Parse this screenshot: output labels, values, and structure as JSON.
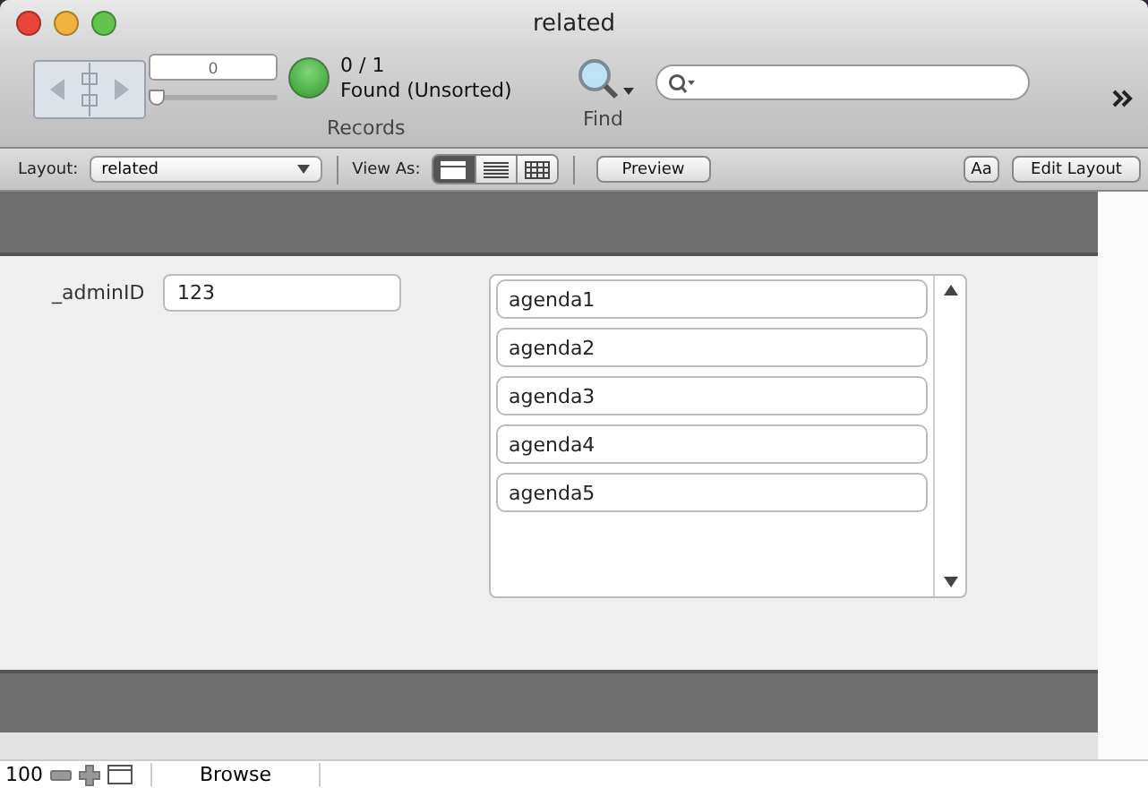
{
  "window": {
    "title": "related"
  },
  "toolbar": {
    "record_number": "0",
    "slider": {
      "level": 0
    },
    "record_count": "0 / 1",
    "found_status": "Found (Unsorted)",
    "records_label": "Records",
    "find_label": "Find"
  },
  "layout_bar": {
    "layout_label": "Layout:",
    "layout_value": "related",
    "view_as_label": "View As:",
    "view_as": [
      {
        "kind": "form",
        "selected": true
      },
      {
        "kind": "list",
        "selected": false
      },
      {
        "kind": "table",
        "selected": false
      }
    ],
    "preview_button": "Preview",
    "text_button": "Aa",
    "edit_button": "Edit Layout"
  },
  "form": {
    "field_label": "_adminID",
    "field_value": "123",
    "portal_rows": [
      {
        "value": "agenda1"
      },
      {
        "value": "agenda2"
      },
      {
        "value": "agenda3"
      },
      {
        "value": "agenda4"
      },
      {
        "value": "agenda5"
      }
    ]
  },
  "status_bar": {
    "zoom": "100",
    "mode": "Browse"
  }
}
